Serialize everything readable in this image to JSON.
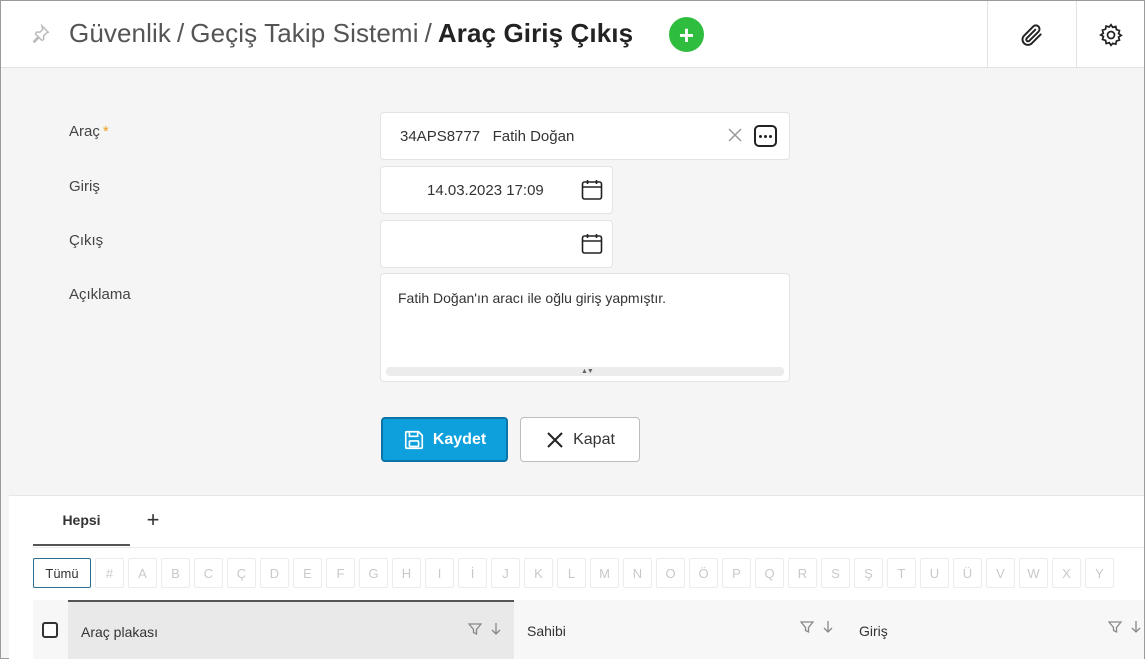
{
  "header": {
    "breadcrumb_1": "Güvenlik",
    "breadcrumb_2": "Geçiş Takip Sistemi",
    "separator": "/",
    "current": "Araç Giriş Çıkış",
    "add_label": "+"
  },
  "form": {
    "arac_label": "Araç",
    "required_mark": "*",
    "arac_value": "34APS8777   Fatih Doğan",
    "giris_label": "Giriş",
    "giris_value": "14.03.2023 17:09",
    "cikis_label": "Çıkış",
    "cikis_value": "",
    "aciklama_label": "Açıklama",
    "aciklama_value": "Fatih Doğan'ın aracı ile oğlu giriş yapmıştır."
  },
  "actions": {
    "save_label": "Kaydet",
    "close_label": "Kapat"
  },
  "grid": {
    "tab_label": "Hepsi",
    "tab_add": "+",
    "all_letters": "Tümü",
    "letters": [
      "#",
      "A",
      "B",
      "C",
      "Ç",
      "D",
      "E",
      "F",
      "G",
      "H",
      "I",
      "İ",
      "J",
      "K",
      "L",
      "M",
      "N",
      "O",
      "Ö",
      "P",
      "Q",
      "R",
      "S",
      "Ş",
      "T",
      "U",
      "Ü",
      "V",
      "W",
      "X",
      "Y"
    ],
    "columns": [
      "Araç plakası",
      "Sahibi",
      "Giriş"
    ]
  },
  "colors": {
    "accent": "#0ea0dc",
    "add_button": "#2ebd3f",
    "required": "#f0a020"
  }
}
